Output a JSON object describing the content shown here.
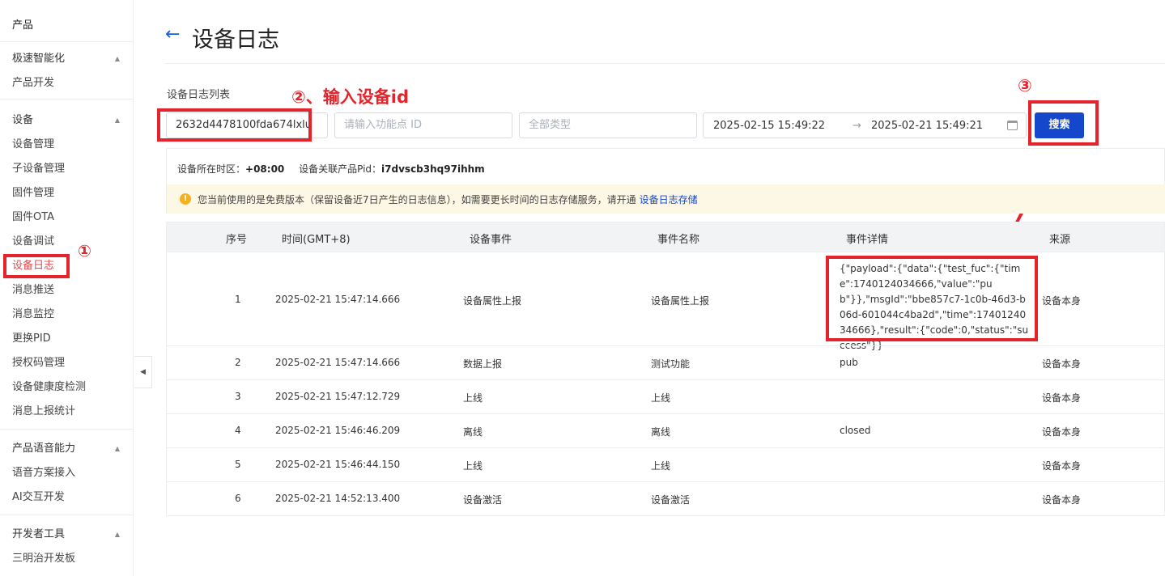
{
  "sidebar": {
    "top_label": "产品",
    "groups": [
      {
        "head": "极速智能化",
        "items": [
          "产品开发"
        ]
      },
      {
        "head": "设备",
        "items": [
          "设备管理",
          "子设备管理",
          "固件管理",
          "固件OTA",
          "设备调试",
          "设备日志",
          "消息推送",
          "消息监控",
          "更换PID",
          "授权码管理",
          "设备健康度检测",
          "消息上报统计"
        ]
      },
      {
        "head": "产品语音能力",
        "items": [
          "语音方案接入",
          "AI交互开发"
        ]
      },
      {
        "head": "开发者工具",
        "items": [
          "三明治开发板"
        ]
      }
    ],
    "active_item": "设备日志"
  },
  "header": {
    "title": "设备日志"
  },
  "list_label": "设备日志列表",
  "filters": {
    "device_id_value": "2632d4478100fda674lxlu",
    "function_id_placeholder": "请输入功能点 ID",
    "type_placeholder": "全部类型",
    "date_start": "2025-02-15  15:49:22",
    "date_arrow": "→",
    "date_end": "2025-02-21  15:49:21",
    "search_label": "搜索"
  },
  "annotations": {
    "step1": "①",
    "step2": "②、输入设备id",
    "step3": "③"
  },
  "info": {
    "timezone_label": "设备所在时区：",
    "timezone_value": "+08:00",
    "pid_label": "设备关联产品Pid：",
    "pid_value": "i7dvscb3hq97ihhm",
    "notice_icon": "!",
    "notice_text": "您当前使用的是免费版本（保留设备近7日产生的日志信息），如需要更长时间的日志存储服务，请开通",
    "notice_link": "设备日志存储"
  },
  "table": {
    "headers": [
      "序号",
      "时间(GMT+8)",
      "设备事件",
      "事件名称",
      "事件详情",
      "来源"
    ],
    "rows": [
      {
        "no": "1",
        "time": "2025-02-21 15:47:14.666",
        "event": "设备属性上报",
        "name": "设备属性上报",
        "detail": "{\"payload\":{\"data\":{\"test_fuc\":{\"time\":1740124034666,\"value\":\"pub\"}},\"msgId\":\"bbe857c7-1c0b-46d3-b06d-601044c4ba2d\",\"time\":1740124034666},\"result\":{\"code\":0,\"status\":\"success\"}}",
        "source": "设备本身"
      },
      {
        "no": "2",
        "time": "2025-02-21 15:47:14.666",
        "event": "数据上报",
        "name": "测试功能",
        "detail": "pub",
        "source": "设备本身"
      },
      {
        "no": "3",
        "time": "2025-02-21 15:47:12.729",
        "event": "上线",
        "name": "上线",
        "detail": "",
        "source": "设备本身"
      },
      {
        "no": "4",
        "time": "2025-02-21 15:46:46.209",
        "event": "离线",
        "name": "离线",
        "detail": "closed",
        "source": "设备本身"
      },
      {
        "no": "5",
        "time": "2025-02-21 15:46:44.150",
        "event": "上线",
        "name": "上线",
        "detail": "",
        "source": "设备本身"
      },
      {
        "no": "6",
        "time": "2025-02-21 14:52:13.400",
        "event": "设备激活",
        "name": "设备激活",
        "detail": "",
        "source": "设备本身"
      }
    ]
  },
  "colors": {
    "accent": "#1447cc",
    "annotation": "#e5232a",
    "active_nav": "#e5484d"
  }
}
